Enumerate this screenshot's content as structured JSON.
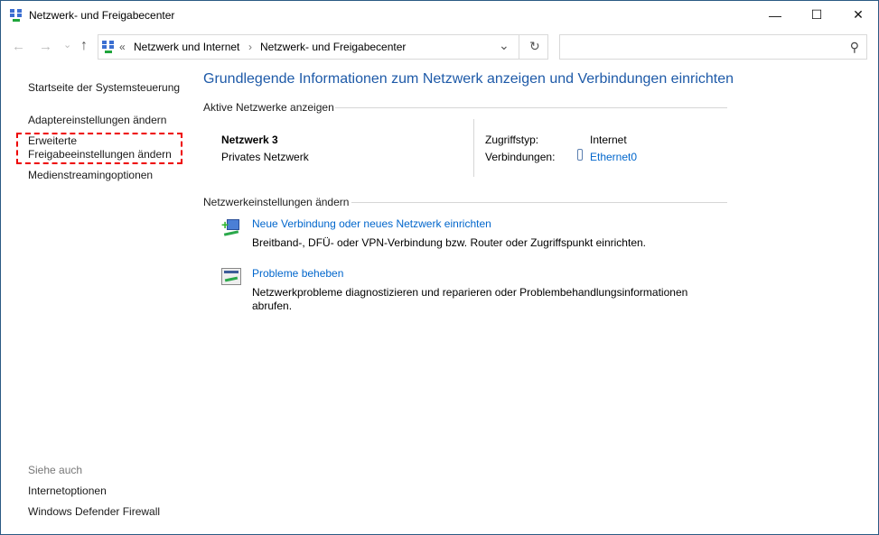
{
  "window": {
    "title": "Netzwerk- und Freigabecenter",
    "minimize": "—",
    "maximize": "☐",
    "close": "✕"
  },
  "nav": {
    "back": "←",
    "forward": "→",
    "recent": "⌄",
    "up": "↑",
    "chevron_left": "«",
    "sep": "›",
    "crumbs": [
      "Netzwerk und Internet",
      "Netzwerk- und Freigabecenter"
    ],
    "dropdown": "⌄",
    "refresh": "↻",
    "search_placeholder": "",
    "search_icon": "⚲"
  },
  "sidebar": {
    "items": [
      "Startseite der Systemsteuerung",
      "Adaptereinstellungen ändern",
      "Erweiterte",
      "Freigabeeinstellungen ändern",
      "Medienstreamingoptionen"
    ],
    "see_also": "Siehe auch",
    "see_also_items": [
      "Internetoptionen",
      "Windows Defender Firewall"
    ]
  },
  "main": {
    "title": "Grundlegende Informationen zum Netzwerk anzeigen und Verbindungen einrichten",
    "active_header": "Aktive Netzwerke anzeigen",
    "network_name": "Netzwerk 3",
    "network_type": "Privates Netzwerk",
    "access_label": "Zugriffstyp:",
    "access_value": "Internet",
    "conn_label": "Verbindungen:",
    "conn_value": "Ethernet0",
    "change_header": "Netzwerkeinstellungen ändern",
    "tasks": [
      {
        "title": "Neue Verbindung oder neues Netzwerk einrichten",
        "desc": "Breitband-, DFÜ- oder VPN-Verbindung bzw. Router oder Zugriffspunkt einrichten."
      },
      {
        "title": "Probleme beheben",
        "desc": "Netzwerkprobleme diagnostizieren und reparieren oder Problembehandlungsinformationen",
        "desc2": "abrufen."
      }
    ]
  }
}
